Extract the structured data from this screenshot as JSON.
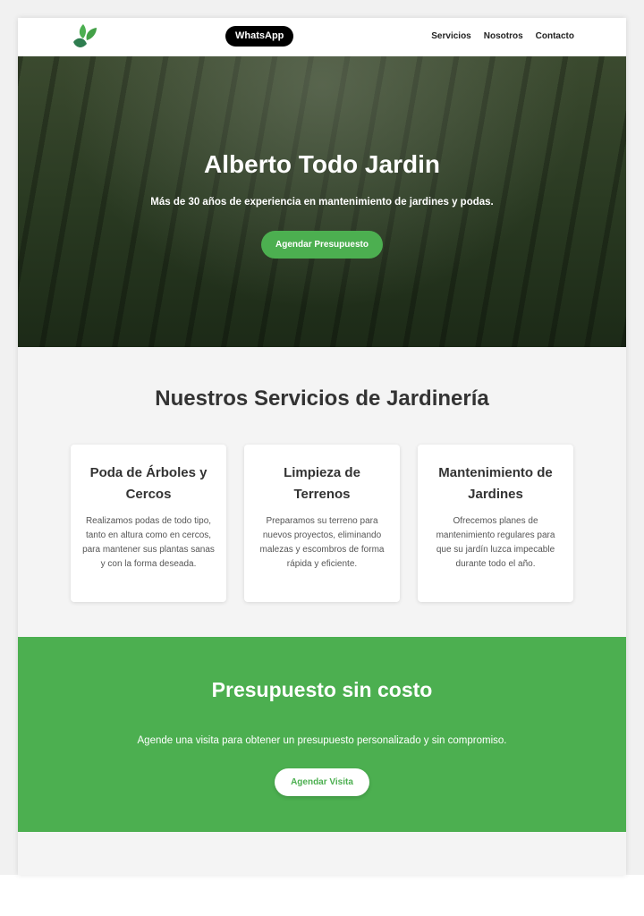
{
  "nav": {
    "whatsapp": "WhatsApp",
    "links": [
      "Servicios",
      "Nosotros",
      "Contacto"
    ]
  },
  "hero": {
    "title": "Alberto Todo Jardin",
    "subtitle": "Más de 30 años de experiencia en mantenimiento de jardines y podas.",
    "button": "Agendar Presupuesto"
  },
  "services": {
    "title": "Nuestros Servicios de Jardinería",
    "cards": [
      {
        "title": "Poda de Árboles y Cercos",
        "text": "Realizamos podas de todo tipo, tanto en altura como en cercos, para mantener sus plantas sanas y con la forma deseada."
      },
      {
        "title": "Limpieza de Terrenos",
        "text": "Preparamos su terreno para nuevos proyectos, eliminando malezas y escombros de forma rápida y eficiente."
      },
      {
        "title": "Mantenimiento de Jardines",
        "text": "Ofrecemos planes de mantenimiento regulares para que su jardín luzca impecable durante todo el año."
      }
    ]
  },
  "cta": {
    "title": "Presupuesto sin costo",
    "text": "Agende una visita para obtener un presupuesto personalizado y sin compromiso.",
    "button": "Agendar Visita"
  },
  "colors": {
    "accent": "#4caf50"
  }
}
